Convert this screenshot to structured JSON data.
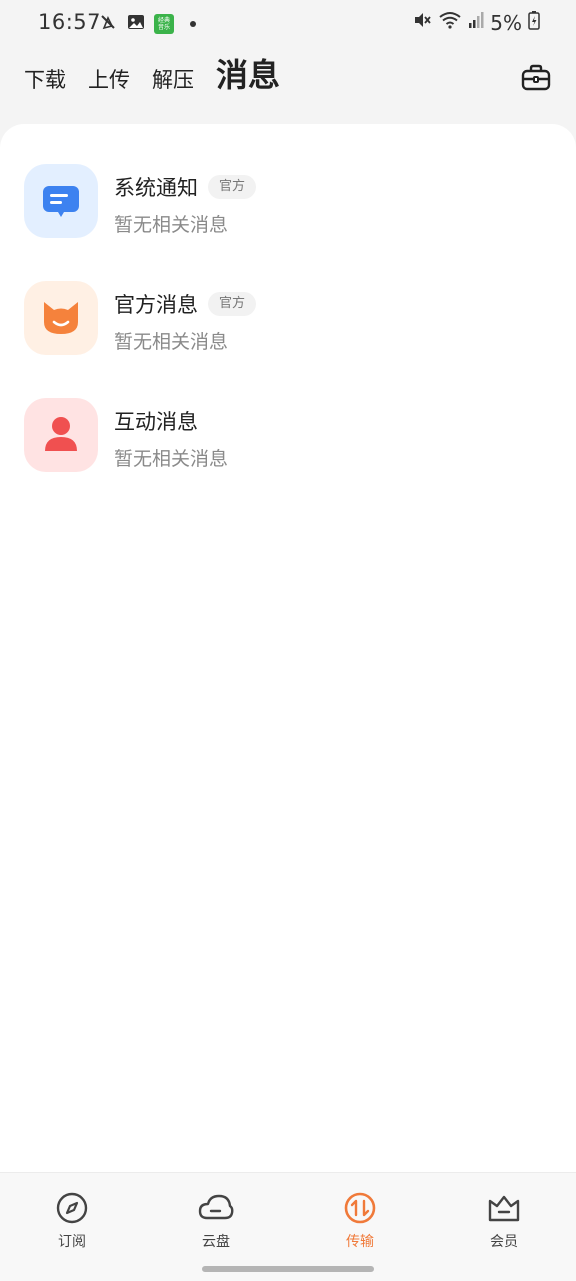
{
  "status_bar": {
    "time": "16:57",
    "battery": "5%",
    "app_badge_text": "经典\n音乐",
    "icons": [
      "strikethrough-hand-icon",
      "image-icon",
      "app-badge-icon",
      "dot-icon",
      "mute-icon",
      "wifi-icon",
      "signal-icon",
      "battery-charging-icon"
    ]
  },
  "tabs": [
    {
      "label": "下载",
      "active": false
    },
    {
      "label": "上传",
      "active": false
    },
    {
      "label": "解压",
      "active": false
    },
    {
      "label": "消息",
      "active": true
    }
  ],
  "header": {
    "toolbox_icon": "toolbox-icon"
  },
  "messages": [
    {
      "title": "系统通知",
      "badge": "官方",
      "subtitle": "暂无相关消息",
      "icon": "chat-bubble-icon",
      "icon_bg": "#e3efff",
      "icon_color": "#3d82f0"
    },
    {
      "title": "官方消息",
      "badge": "官方",
      "subtitle": "暂无相关消息",
      "icon": "cat-face-icon",
      "icon_bg": "#fff0e4",
      "icon_color": "#f5823c"
    },
    {
      "title": "互动消息",
      "badge": "",
      "subtitle": "暂无相关消息",
      "icon": "person-icon",
      "icon_bg": "#ffe3e3",
      "icon_color": "#f05050"
    }
  ],
  "bottom_nav": [
    {
      "label": "订阅",
      "icon": "compass-icon",
      "active": false
    },
    {
      "label": "云盘",
      "icon": "cloud-icon",
      "active": false
    },
    {
      "label": "传输",
      "icon": "transfer-icon",
      "active": true
    },
    {
      "label": "会员",
      "icon": "crown-icon",
      "active": false
    }
  ],
  "colors": {
    "accent": "#f07a3a",
    "background": "#f4f4f4",
    "panel": "#ffffff",
    "text": "#222222",
    "subtext": "#8a8a8a"
  }
}
